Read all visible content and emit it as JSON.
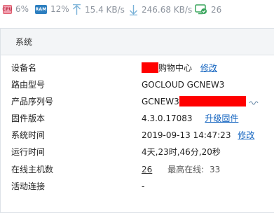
{
  "status_bar": {
    "cpu_chip": "CPU",
    "cpu_value": "6%",
    "ram_chip": "RAM",
    "ram_value": "12%",
    "upload_value": "15.4 KB/s",
    "download_value": "246.68 KB/s",
    "devices_value": "26"
  },
  "panel": {
    "title": "系统",
    "rows": [
      {
        "label": "设备名",
        "value": "购物中心",
        "action": "修改"
      },
      {
        "label": "路由型号",
        "value": "GOCLOUD GCNEW3"
      },
      {
        "label": "产品序列号",
        "value": "GCNEW3"
      },
      {
        "label": "固件版本",
        "value": "4.3.0.17083",
        "action": "升级固件"
      },
      {
        "label": "系统时间",
        "value": "2019-09-13 14:47:23",
        "action": "修改"
      },
      {
        "label": "运行时间",
        "value": "4天,23时,46分,20秒"
      },
      {
        "label": "在线主机数",
        "value": "26",
        "extra_label": "最高在线:",
        "extra_value": "33"
      },
      {
        "label": "活动连接",
        "value": "-"
      }
    ]
  },
  "colors": {
    "link": "#1565c0",
    "redaction": "#ff0000",
    "header_bg": "#f3f5f7"
  }
}
